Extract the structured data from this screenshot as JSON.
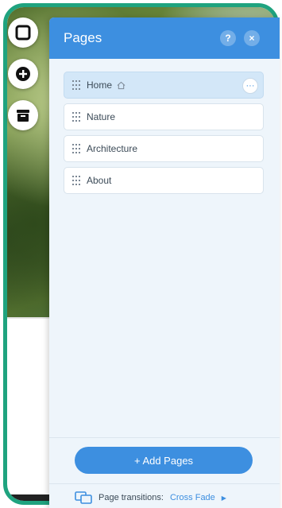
{
  "panel": {
    "title": "Pages",
    "help_label": "?",
    "close_label": "×"
  },
  "pages": [
    {
      "label": "Home",
      "is_home": true,
      "active": true
    },
    {
      "label": "Nature"
    },
    {
      "label": "Architecture"
    },
    {
      "label": "About"
    }
  ],
  "more_label": "···",
  "add_pages_label": "+ Add Pages",
  "transitions": {
    "label": "Page transitions:",
    "value": "Cross Fade",
    "arrow": "▶"
  },
  "colors": {
    "frame": "#1fa37f",
    "accent": "#3d8fe0",
    "panel_bg": "#eef5fb",
    "active_item": "#d3e7f8"
  },
  "icons": [
    "square-icon",
    "plus-circle-icon",
    "archive-icon",
    "drag-handle-icon",
    "home-icon",
    "transitions-icon"
  ]
}
